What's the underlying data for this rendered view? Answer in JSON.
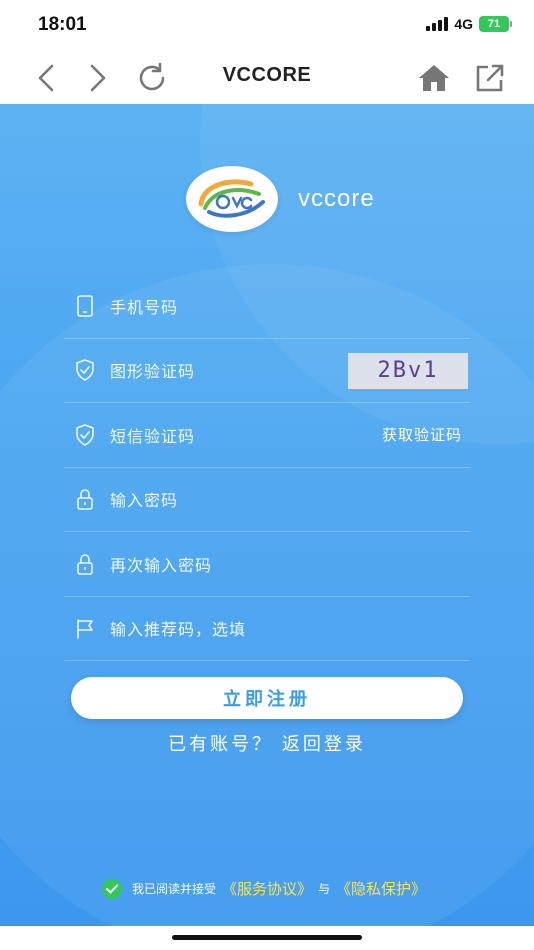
{
  "status_bar": {
    "time": "18:01",
    "network": "4G",
    "battery": "71",
    "battery_color": "#34c759"
  },
  "browser": {
    "title": "VCCORE",
    "icons": [
      "back-icon",
      "forward-icon",
      "refresh-icon",
      "home-icon",
      "share-icon"
    ]
  },
  "brand": {
    "name": "vccore"
  },
  "form": {
    "phone_placeholder": "手机号码",
    "captcha_placeholder": "图形验证码",
    "captcha_image_text": "2Bv1",
    "sms_placeholder": "短信验证码",
    "sms_action": "获取验证码",
    "password_placeholder": "输入密码",
    "password_confirm_placeholder": "再次输入密码",
    "referral_placeholder": "输入推荐码，选填"
  },
  "actions": {
    "register_label": "立即注册",
    "login_link": "已有账号？ 返回登录"
  },
  "agreement": {
    "prefix": "我已阅读并接受",
    "service_link": "《服务协议》",
    "connector": "与",
    "privacy_link": "《隐私保护》"
  },
  "colors": {
    "accent": "#3b9bee",
    "link_yellow": "#ffe34a"
  }
}
